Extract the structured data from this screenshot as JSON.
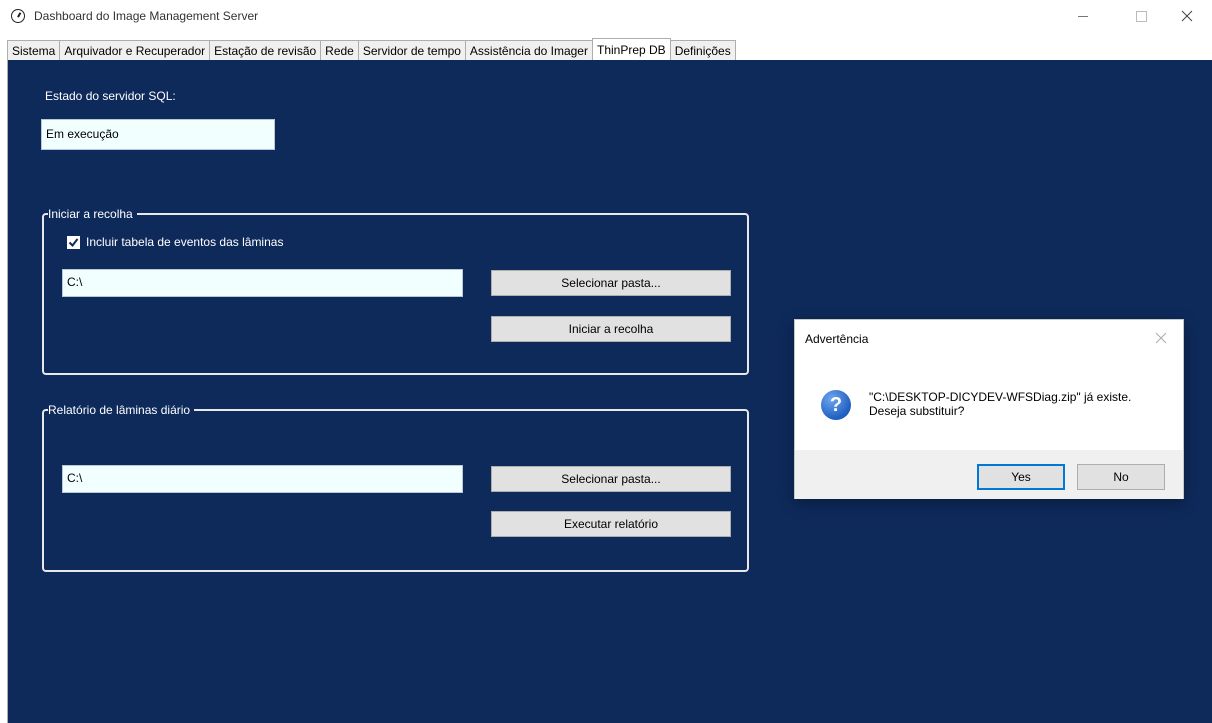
{
  "window": {
    "title": "Dashboard do Image Management Server"
  },
  "tabs": [
    {
      "label": "Sistema"
    },
    {
      "label": "Arquivador e Recuperador"
    },
    {
      "label": "Estação de revisão"
    },
    {
      "label": "Rede"
    },
    {
      "label": "Servidor de tempo"
    },
    {
      "label": "Assistência do Imager"
    },
    {
      "label": "ThinPrep DB"
    },
    {
      "label": "Definições"
    }
  ],
  "active_tab": "ThinPrep DB",
  "sql_status": {
    "label": "Estado do servidor SQL:",
    "value": "Em execução"
  },
  "collection": {
    "title": "Iniciar a recolha",
    "checkbox_label": "Incluir tabela de eventos das lâminas",
    "checkbox_checked": true,
    "path_value": "C:\\",
    "select_folder_label": "Selecionar pasta...",
    "start_label": "Iniciar a recolha"
  },
  "daily_report": {
    "title": "Relatório de lâminas diário",
    "path_value": "C:\\",
    "select_folder_label": "Selecionar pasta...",
    "run_label": "Executar relatório"
  },
  "dialog": {
    "title": "Advertência",
    "message_line1": "\"C:\\DESKTOP-DICYDEV-WFSDiag.zip\" já existe.",
    "message_line2": "Deseja substituir?",
    "yes_label": "Yes",
    "no_label": "No",
    "icon": "question-icon"
  },
  "colors": {
    "panel_bg": "#0e2a5b",
    "textbox_bg": "#f1ffff",
    "accent": "#0078d7"
  }
}
